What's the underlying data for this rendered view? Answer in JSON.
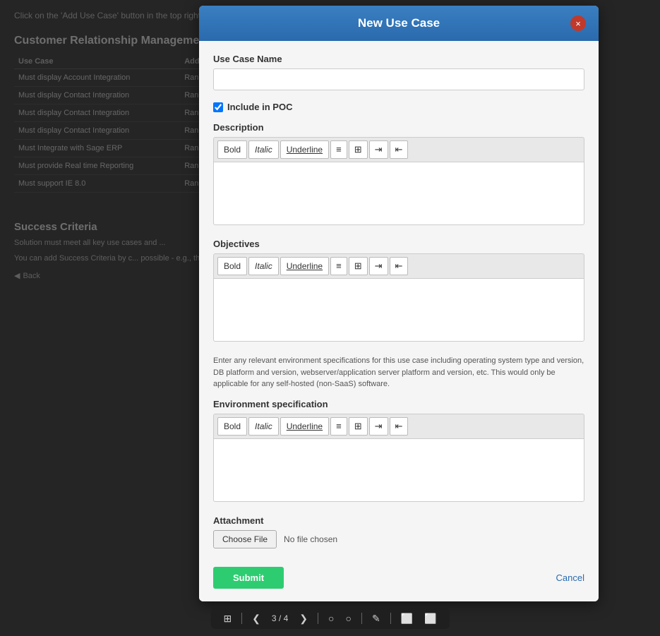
{
  "background": {
    "header_text": "Click on the 'Add Use Case' button in the top right to see the list of vendors and their information.",
    "section_title": "Customer Relationship Manageme...",
    "table": {
      "columns": [
        "Use Case",
        "Add"
      ],
      "rows": [
        [
          "Must display Account Integration",
          "Ran"
        ],
        [
          "Must display Contact Integration",
          "Ran"
        ],
        [
          "Must display Contact Integration",
          "Ran"
        ],
        [
          "Must display Contact Integration",
          "Ran"
        ],
        [
          "Must Integrate with Sage ERP",
          "Ran"
        ],
        [
          "Must provide Real time Reporting",
          "Ran"
        ],
        [
          "Must support IE 8.0",
          "Ran"
        ]
      ]
    },
    "bottom_section_title": "Success Criteria",
    "bottom_text1": "Solution must meet all key use cases and ...",
    "bottom_text2": "You can add Success Criteria by c... possible - e.g., the prod...",
    "back_label": "Back"
  },
  "modal": {
    "title": "New Use Case",
    "close_icon": "×",
    "fields": {
      "use_case_name_label": "Use Case Name",
      "use_case_name_placeholder": "",
      "include_in_poc_label": "Include in POC",
      "include_in_poc_checked": true,
      "description_label": "Description",
      "objectives_label": "Objectives",
      "env_info_text": "Enter any relevant environment specifications for this use case including operating system type and version, DB platform and version, webserver/application server platform and version, etc. This would only be applicable for any self-hosted (non-SaaS) software.",
      "env_spec_label": "Environment specification",
      "attachment_label": "Attachment",
      "choose_file_label": "Choose File",
      "no_file_text": "No file chosen"
    },
    "toolbar": {
      "bold": "Bold",
      "italic": "Italic",
      "underline": "Underline",
      "list_icon": "≡",
      "grid_icon": "⊞",
      "indent_icon": "⇥",
      "outdent_icon": "⇤"
    },
    "footer": {
      "submit_label": "Submit",
      "cancel_label": "Cancel"
    }
  },
  "page_toolbar": {
    "grid_icon": "⊞",
    "prev_icon": "❮",
    "page_indicator": "3 / 4",
    "next_icon": "❯",
    "circle1": "○",
    "circle2": "○",
    "pencil_icon": "✎",
    "box1_icon": "⬜",
    "box2_icon": "⬜"
  }
}
